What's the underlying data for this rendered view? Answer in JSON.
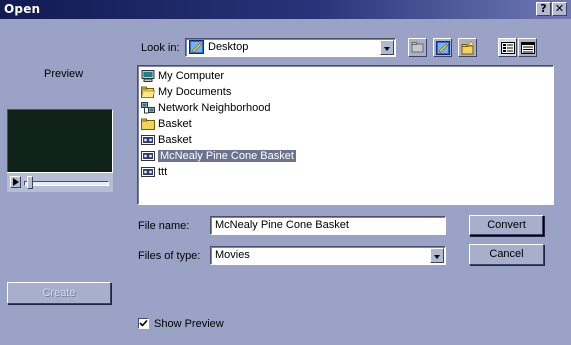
{
  "window": {
    "title": "Open",
    "help_label": "?",
    "close_label": "✕"
  },
  "look_in": {
    "label": "Look in:",
    "value": "Desktop",
    "icon": "desktop-icon"
  },
  "toolbar": {
    "icons": [
      "up-folder-icon",
      "desktop-icon",
      "new-folder-icon",
      "list-view-icon",
      "details-view-icon"
    ]
  },
  "preview": {
    "label": "Preview",
    "create_label": "Create"
  },
  "files": [
    {
      "name": "My Computer",
      "icon": "computer-icon",
      "selected": false
    },
    {
      "name": "My Documents",
      "icon": "folder-open-icon",
      "selected": false
    },
    {
      "name": "Network Neighborhood",
      "icon": "network-icon",
      "selected": false
    },
    {
      "name": "Basket",
      "icon": "folder-icon",
      "selected": false
    },
    {
      "name": "Basket",
      "icon": "movie-file-icon",
      "selected": false
    },
    {
      "name": "McNealy Pine Cone Basket",
      "icon": "movie-file-icon",
      "selected": true
    },
    {
      "name": "ttt",
      "icon": "movie-file-icon",
      "selected": false
    }
  ],
  "file_name": {
    "label": "File name:",
    "value": "McNealy Pine Cone Basket"
  },
  "file_type": {
    "label": "Files of type:",
    "value": "Movies"
  },
  "buttons": {
    "convert": "Convert",
    "cancel": "Cancel"
  },
  "show_preview": {
    "label": "Show Preview",
    "checked": true
  }
}
